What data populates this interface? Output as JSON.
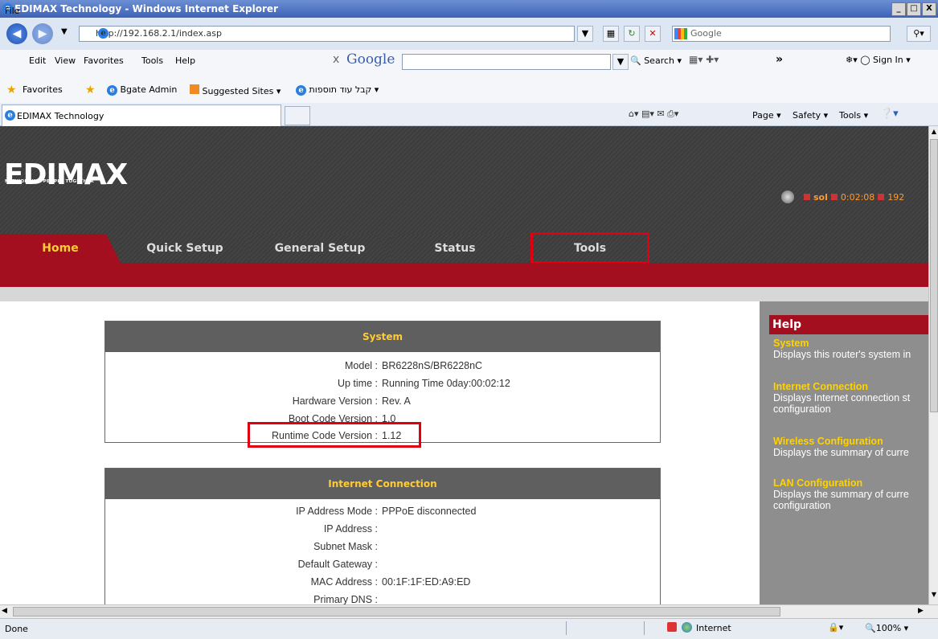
{
  "window": {
    "title": "EDIMAX Technology - Windows Internet Explorer",
    "controls": [
      "_",
      "□",
      "X"
    ]
  },
  "address": {
    "url": "http://192.168.2.1/index.asp",
    "search_placeholder": "Google"
  },
  "menu": [
    "File",
    "Edit",
    "View",
    "Favorites",
    "Tools",
    "Help"
  ],
  "google_toolbar": {
    "close": "x",
    "logo": "Google",
    "search_label": "Search",
    "more": "»",
    "sign_in": "Sign In"
  },
  "favorites": {
    "label": "Favorites",
    "items": [
      "Bgate Admin",
      "Suggested Sites",
      "קבל עוד תוספות"
    ]
  },
  "tab": {
    "label": "EDIMAX Technology"
  },
  "command_bar": {
    "page": "Page",
    "safety": "Safety",
    "tools": "Tools"
  },
  "router": {
    "brand": "EDIMAX",
    "slogan": "NETWORKING PEOPLE TOGETHER",
    "status_user": "sol",
    "status_time": "0:02:08",
    "status_ip": "192",
    "nav_tabs": [
      "Home",
      "Quick Setup",
      "General Setup",
      "Status",
      "Tools"
    ],
    "active_tab": "Home",
    "sections": [
      {
        "title": "System",
        "rows": [
          {
            "label": "Model :",
            "value": "BR6228nS/BR6228nC"
          },
          {
            "label": "Up time :",
            "value": "Running Time 0day:00:02:12"
          },
          {
            "label": "Hardware Version :",
            "value": "Rev. A"
          },
          {
            "label": "Boot Code Version :",
            "value": "1.0"
          },
          {
            "label": "Runtime Code Version :",
            "value": "1.12"
          }
        ]
      },
      {
        "title": "Internet Connection",
        "rows": [
          {
            "label": "IP Address Mode :",
            "value": "PPPoE disconnected"
          },
          {
            "label": "IP Address :",
            "value": ""
          },
          {
            "label": "Subnet Mask :",
            "value": ""
          },
          {
            "label": "Default Gateway :",
            "value": ""
          },
          {
            "label": "MAC Address :",
            "value": "00:1F:1F:ED:A9:ED"
          },
          {
            "label": "Primary DNS :",
            "value": ""
          }
        ]
      }
    ],
    "help": {
      "title": "Help",
      "items": [
        {
          "heading": "System",
          "text": "Displays this router's system in"
        },
        {
          "heading": "Internet Connection",
          "text": "Displays Internet connection st configuration"
        },
        {
          "heading": "Wireless Configuration",
          "text": "Displays the summary of curre"
        },
        {
          "heading": "LAN Configuration",
          "text": "Displays the summary of curre configuration"
        }
      ]
    }
  },
  "statusbar": {
    "left": "Done",
    "zone": "Internet",
    "zoom": "100%"
  },
  "colors": {
    "accent_red": "#a40f20",
    "highlight_box": "#e00010",
    "help_heading": "#ffd200"
  }
}
